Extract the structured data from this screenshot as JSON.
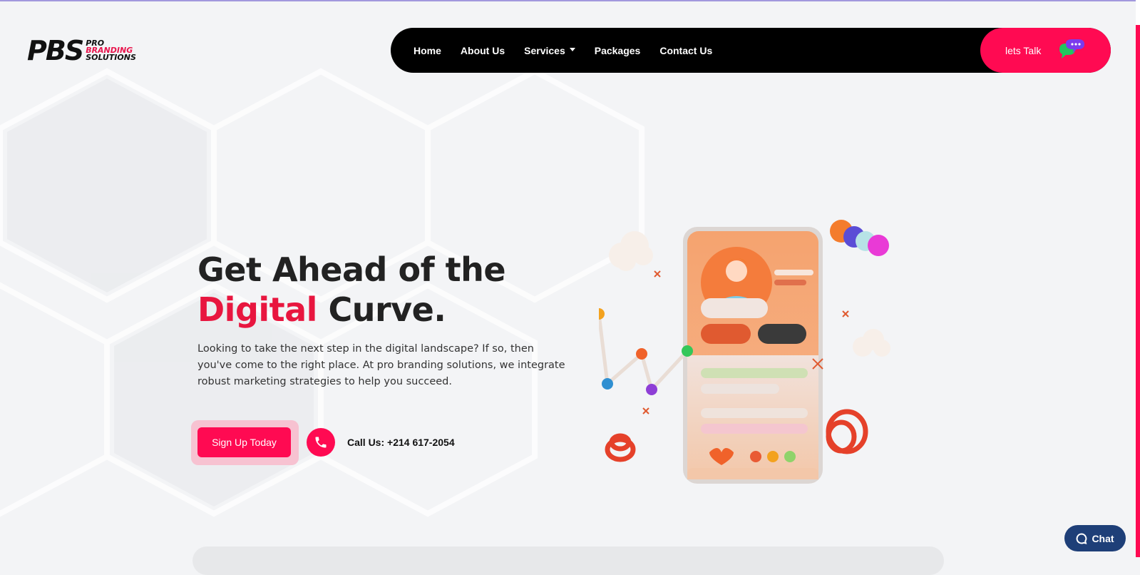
{
  "brand": {
    "logo_mark": "PBS",
    "logo_line1": "PRO",
    "logo_line2": "BRANDING",
    "logo_line3": "SOLUTIONS"
  },
  "nav": {
    "items": [
      {
        "label": "Home"
      },
      {
        "label": "About Us"
      },
      {
        "label": "Services"
      },
      {
        "label": "Packages"
      },
      {
        "label": "Contact Us"
      }
    ],
    "cta_label": "lets Talk"
  },
  "hero": {
    "title_line1": "Get Ahead of the",
    "title_accent": "Digital",
    "title_rest": " Curve.",
    "description": "Looking to take the next step in the digital landscape? If so, then you've come to the right place. At pro branding solutions, we integrate robust marketing strategies to help you succeed.",
    "signup_label": "Sign Up Today",
    "call_text": "Call Us: +214 617-2054"
  },
  "chat_widget": {
    "label": "Chat"
  },
  "colors": {
    "accent": "#ff0a52",
    "accent_text": "#e8163f",
    "nav_bg": "#000000",
    "chat_widget_bg": "#1e3f78"
  }
}
